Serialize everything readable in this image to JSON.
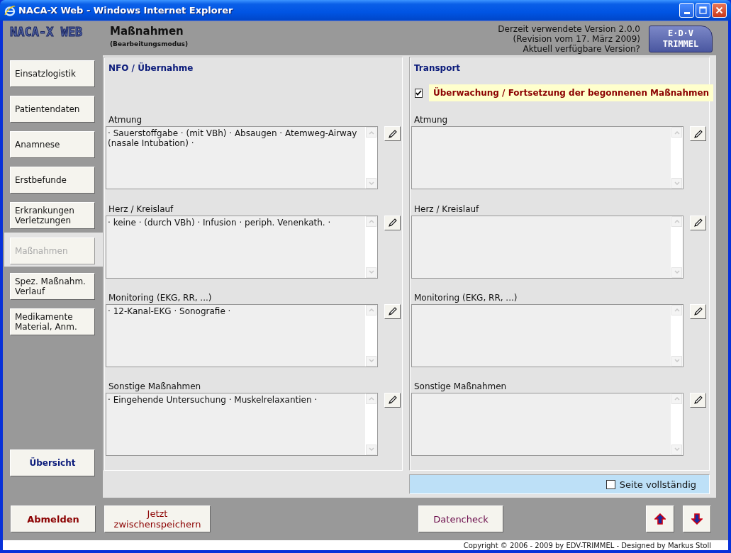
{
  "window": {
    "title": "NACA-X Web - Windows Internet Explorer"
  },
  "header": {
    "logo": "NACA-X WEB",
    "title": "Maßnahmen",
    "subtitle": "(Bearbeitungsmodus)",
    "version_lines": [
      "Derzeit verwendete Version 2.0.0",
      "(Revision vom 17. März 2009)",
      "Aktuell verfügbare Version?"
    ],
    "brand_logo": [
      "E·D·V",
      "TRIMMEL"
    ]
  },
  "sidebar": {
    "items": [
      {
        "label": "Einsatzlogistik",
        "selected": false
      },
      {
        "label": "Patientendaten",
        "selected": false
      },
      {
        "label": "Anamnese",
        "selected": false
      },
      {
        "label": "Erstbefunde",
        "selected": false
      },
      {
        "label": "Erkrankungen\nVerletzungen",
        "selected": false
      },
      {
        "label": "Maßnahmen",
        "selected": true
      },
      {
        "label": "Spez. Maßnahm.\nVerlauf",
        "selected": false
      },
      {
        "label": "Medikamente\nMaterial, Anm.",
        "selected": false
      }
    ],
    "overview": "Übersicht"
  },
  "panels": [
    {
      "title": "NFO / Übernahme",
      "sections": [
        {
          "label": "Atmung",
          "value": "· Sauerstoffgabe · (mit VBh) · Absaugen · Atemweg-Airway (nasale Intubation) ·"
        },
        {
          "label": "Herz / Kreislauf",
          "value": "· keine · (durch VBh) · Infusion · periph. Venenkath. ·"
        },
        {
          "label": "Monitoring (EKG, RR, ...)",
          "value": "· 12-Kanal-EKG · Sonografie ·"
        },
        {
          "label": "Sonstige Maßnahmen",
          "value": "· Eingehende Untersuchung · Muskelrelaxantien ·"
        }
      ]
    },
    {
      "title": "Transport",
      "check": {
        "label": "Überwachung / Fortsetzung der begonnenen Maßnahmen",
        "checked": true
      },
      "sections": [
        {
          "label": "Atmung"
        },
        {
          "label": "Herz / Kreislauf"
        },
        {
          "label": "Monitoring (EKG, RR, ...)"
        },
        {
          "label": "Sonstige Maßnahmen"
        }
      ]
    }
  ],
  "complete_check": {
    "label": "Seite vollständig",
    "checked": false
  },
  "bottom_buttons": [
    {
      "label": "Abmelden",
      "kind": "logout"
    },
    {
      "label": "Jetzt\nzwischenspeichern",
      "kind": "save"
    },
    {
      "label": "Datencheck",
      "kind": "check"
    }
  ],
  "footer": "Copyright © 2006 - 2009 by EDV-TRIMMEL - Designed by Markus Stoll"
}
